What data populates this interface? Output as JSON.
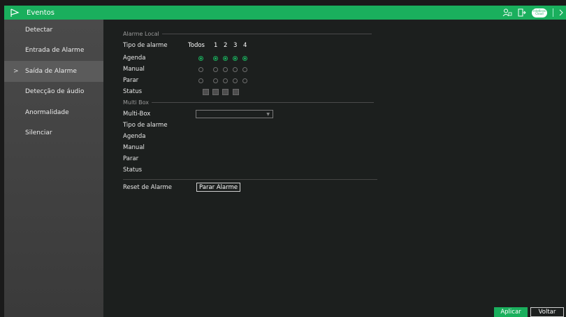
{
  "header": {
    "title": "Eventos",
    "cloud_text": "Intelbras Cloud",
    "accent_color": "#1aaf5d"
  },
  "sidebar": {
    "items": [
      {
        "label": "Detectar"
      },
      {
        "label": "Entrada de Alarme"
      },
      {
        "label": "Saída de Alarme",
        "active": true,
        "arrow": ">"
      },
      {
        "label": "Detecção de áudio"
      },
      {
        "label": "Anormalidade"
      },
      {
        "label": "Silenciar"
      }
    ]
  },
  "local": {
    "section": "Alarme Local",
    "type_label": "Tipo de alarme",
    "col_all": "Todos",
    "cols": [
      "1",
      "2",
      "3",
      "4"
    ],
    "rows": [
      "Agenda",
      "Manual",
      "Parar",
      "Status"
    ],
    "selected_row": "Agenda"
  },
  "multibox": {
    "section": "Multi Box",
    "label": "Multi-Box",
    "select_value": "",
    "rows": [
      "Tipo de alarme",
      "Agenda",
      "Manual",
      "Parar",
      "Status"
    ]
  },
  "reset": {
    "label": "Reset de Alarme",
    "button": "Parar Alarme"
  },
  "footer": {
    "apply": "Aplicar",
    "back": "Voltar"
  }
}
